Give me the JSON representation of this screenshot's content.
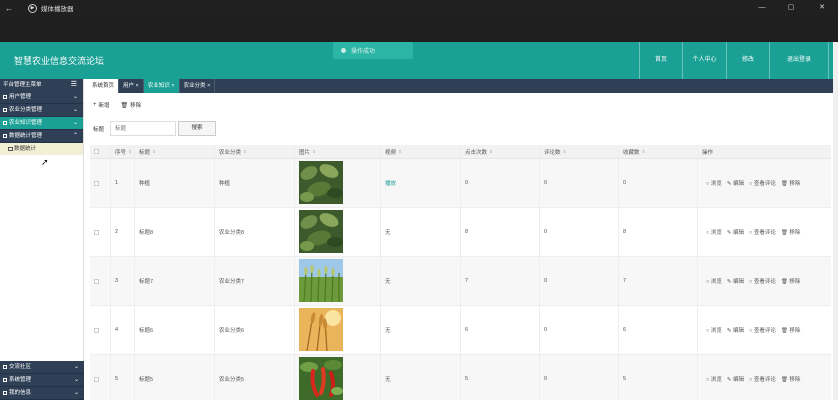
{
  "window": {
    "back": "←",
    "app_icon": "play-circle-icon",
    "title": "媒体播放器",
    "minimize": "—",
    "maximize": "▢",
    "close": "✕"
  },
  "header": {
    "site_title": "智慧农业信息交流论坛",
    "nav": [
      "首页",
      "个人中心",
      "修改",
      "退出登录"
    ]
  },
  "toast": {
    "text": "操作成功"
  },
  "sidebar": {
    "title": "平台管理主菜单",
    "items_top": [
      {
        "label": "用户管理",
        "state": "collapsed"
      },
      {
        "label": "农业分类管理",
        "state": "collapsed"
      },
      {
        "label": "农业知识管理",
        "state": "active"
      },
      {
        "label": "数据统计管理",
        "state": "expanded"
      }
    ],
    "sub_item": "数据统计",
    "items_bottom": [
      {
        "label": "交流社区"
      },
      {
        "label": "系统管理"
      },
      {
        "label": "我的信息"
      }
    ]
  },
  "tabs": [
    {
      "label": "系统首页",
      "closable": false
    },
    {
      "label": "用户",
      "closable": true
    },
    {
      "label": "农业知识",
      "closable": true
    },
    {
      "label": "农业分类",
      "closable": true
    }
  ],
  "toolbar": {
    "add": "新增",
    "delete": "移除"
  },
  "search": {
    "label": "标题",
    "placeholder": "标题",
    "button": "搜索"
  },
  "table": {
    "columns": [
      "序号",
      "标题",
      "农业分类",
      "图片",
      "视频",
      "点击次数",
      "评论数",
      "收藏数",
      "操作"
    ],
    "rows": [
      {
        "no": "1",
        "title": "种植",
        "category": "种植",
        "image": "crop-leaves",
        "video": "播放",
        "clicks": "0",
        "comments": "0",
        "favorites": "0"
      },
      {
        "no": "2",
        "title": "标题8",
        "category": "农业分类8",
        "image": "crop-leaves",
        "video": "无",
        "clicks": "8",
        "comments": "0",
        "favorites": "8"
      },
      {
        "no": "3",
        "title": "标题7",
        "category": "农业分类7",
        "image": "wheat-field",
        "video": "无",
        "clicks": "7",
        "comments": "0",
        "favorites": "7"
      },
      {
        "no": "4",
        "title": "标题6",
        "category": "农业分类6",
        "image": "wheat-sunset",
        "video": "无",
        "clicks": "6",
        "comments": "0",
        "favorites": "6"
      },
      {
        "no": "5",
        "title": "标题5",
        "category": "农业分类5",
        "image": "chili-peppers",
        "video": "无",
        "clicks": "5",
        "comments": "0",
        "favorites": "5"
      }
    ],
    "actions": [
      "浏览",
      "编辑",
      "查看评论",
      "移除"
    ]
  },
  "colors": {
    "header": "#1aa094",
    "sidebar": "#2f4056",
    "accent": "#1aa094"
  }
}
